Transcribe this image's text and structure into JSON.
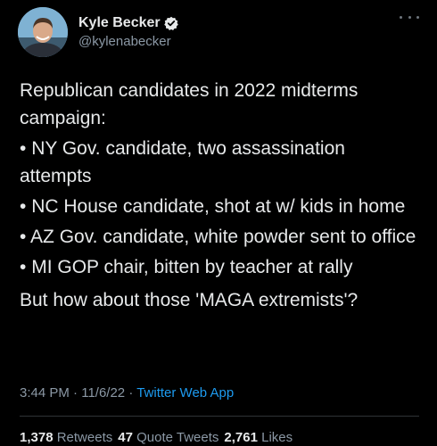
{
  "author": {
    "display_name": "Kyle Becker",
    "handle": "@kylenabecker",
    "verified_icon": "verified-badge-icon",
    "avatar_icon": "avatar-photo"
  },
  "tweet": {
    "intro_line1": "Republican candidates in 2022 midterms",
    "intro_line2": "campaign:",
    "bullets": [
      "NY Gov. candidate, two assassination attempts",
      "NC House candidate, shot at w/ kids in home",
      "AZ Gov. candidate, white powder sent to office",
      "MI GOP chair, bitten by teacher at rally"
    ],
    "bullet_marker": "•",
    "closing": "But how about those 'MAGA extremists'?"
  },
  "meta": {
    "time": "3:44 PM",
    "sep": " · ",
    "date": "11/6/22",
    "source": "Twitter Web App"
  },
  "stats": {
    "retweets_count": "1,378",
    "retweets_label": "Retweets",
    "quotes_count": "47",
    "quotes_label": "Quote Tweets",
    "likes_count": "2,761",
    "likes_label": "Likes"
  },
  "colors": {
    "background": "#000000",
    "text": "#e7e9ea",
    "secondary": "#8b98a5",
    "accent": "#1d9bf0"
  }
}
